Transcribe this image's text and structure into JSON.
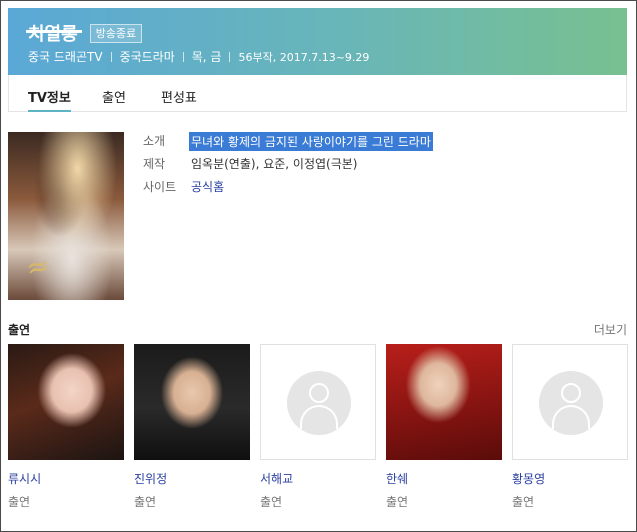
{
  "header": {
    "title": "치열롱",
    "status_badge": "방송종료",
    "meta": [
      "중국 드래곤TV",
      "중국드라마",
      "목, 금",
      "56부작, 2017.7.13~9.29"
    ]
  },
  "tabs": [
    {
      "label": "TV정보",
      "active": true
    },
    {
      "label": "출연",
      "active": false
    },
    {
      "label": "편성표",
      "active": false
    }
  ],
  "info": {
    "synopsis_label": "소개",
    "synopsis_value": "무녀와 황제의 금지된 사랑이야기를 그린 드라마",
    "production_label": "제작",
    "production_value": "임옥분(연출), 요준, 이정엽(극본)",
    "site_label": "사이트",
    "site_value": "공식홈"
  },
  "cast_section": {
    "heading": "출연",
    "more_label": "더보기",
    "members": [
      {
        "name": "류시시",
        "role": "출연",
        "has_photo": true
      },
      {
        "name": "진위정",
        "role": "출연",
        "has_photo": true
      },
      {
        "name": "서해교",
        "role": "출연",
        "has_photo": false
      },
      {
        "name": "한쉐",
        "role": "출연",
        "has_photo": true
      },
      {
        "name": "황몽영",
        "role": "출연",
        "has_photo": false
      }
    ]
  },
  "colors": {
    "banner_start": "#5aa8d6",
    "banner_end": "#78c090",
    "link": "#2a3fa0",
    "highlight": "#3a7bd5",
    "tab_underline": "#5cb4c4"
  },
  "icons": [
    "person-placeholder-icon"
  ]
}
